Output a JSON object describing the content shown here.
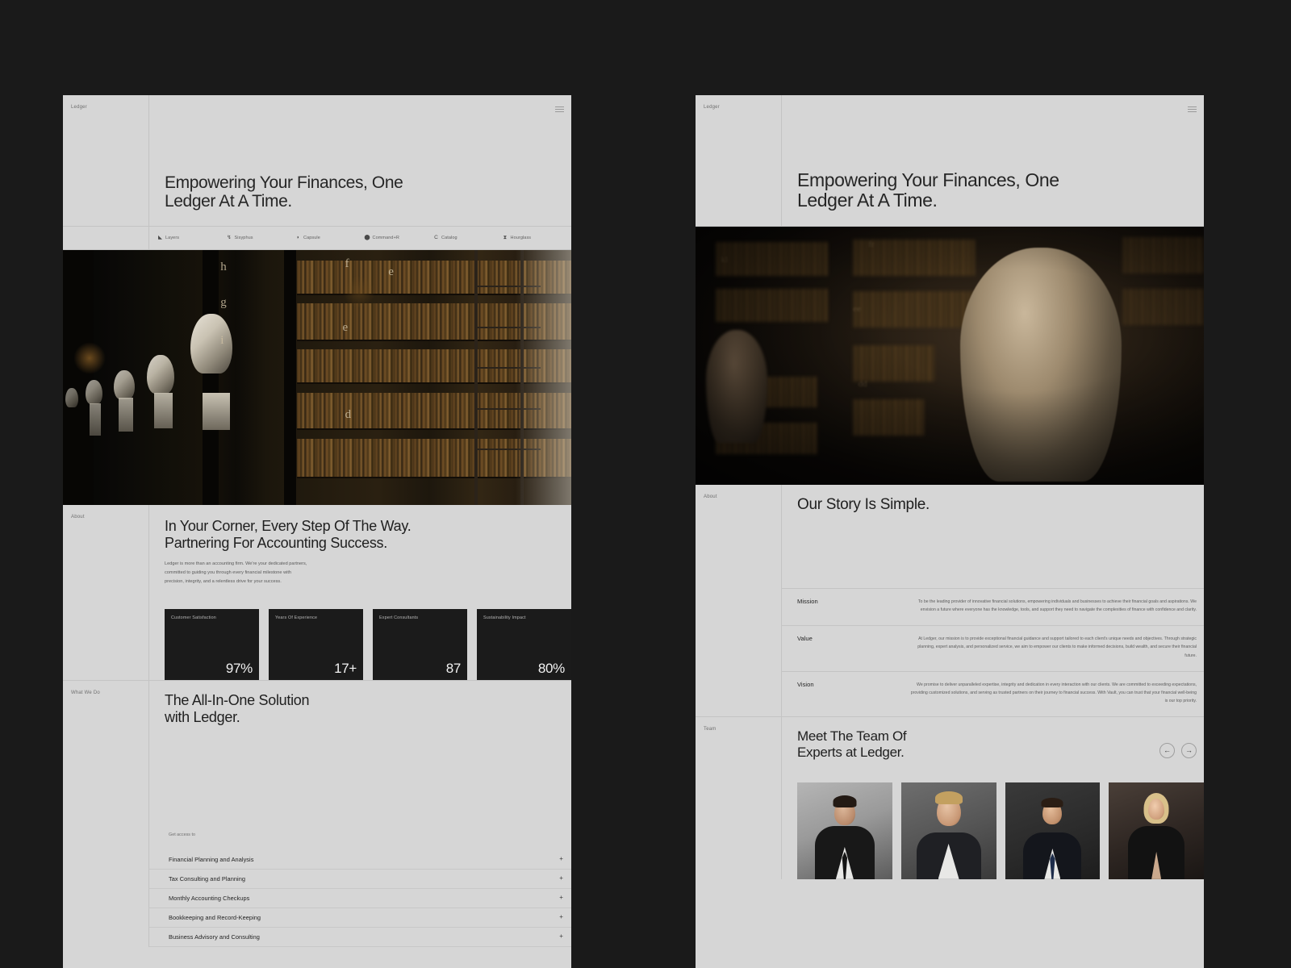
{
  "brand": "Ledger",
  "hero": {
    "title": "Empowering Your Finances, One\nLedger At A Time.",
    "menu_icon": "hamburger-icon"
  },
  "logos": [
    {
      "name": "Layers",
      "glyph": "◣"
    },
    {
      "name": "Sisyphus",
      "glyph": "↯"
    },
    {
      "name": "Capsule",
      "glyph": "◗"
    },
    {
      "name": "Command+R",
      "glyph": "⬤"
    },
    {
      "name": "Catalog",
      "glyph": "C"
    },
    {
      "name": "Hourglass",
      "glyph": "⧗"
    }
  ],
  "about": {
    "rail_label": "About",
    "heading": "In Your Corner, Every Step Of The Way.\nPartnering For Accounting Success.",
    "paragraph": "Ledger is more than an accounting firm. We're your dedicated partners, committed to guiding you through every financial milestone with precision, integrity, and a relentless drive for your success.",
    "stats": [
      {
        "label": "Customer Satisfaction",
        "value": "97%"
      },
      {
        "label": "Years Of Experience",
        "value": "17+"
      },
      {
        "label": "Expert Consultants",
        "value": "87"
      },
      {
        "label": "Sustainability Impact",
        "value": "80%"
      }
    ]
  },
  "what_we_do": {
    "rail_label": "What We Do",
    "heading": "The All-In-One Solution\nwith Ledger.",
    "get_access_label": "Get access to",
    "expand_icon": "+",
    "items": [
      "Financial Planning and Analysis",
      "Tax Consulting and Planning",
      "Monthly Accounting Checkups",
      "Bookkeeping and Record-Keeping",
      "Business Advisory and Consulting"
    ]
  },
  "story": {
    "rail_label": "About",
    "heading": "Our Story Is Simple.",
    "rows": [
      {
        "key": "Mission",
        "text": "To be the leading provider of innovative financial solutions, empowering individuals and businesses to achieve their financial goals and aspirations. We envision a future where everyone has the knowledge, tools, and support they need to navigate the complexities of finance with confidence and clarity."
      },
      {
        "key": "Value",
        "text": "At Ledger, our mission is to provide exceptional financial guidance and support tailored to each client's unique needs and objectives. Through strategic planning, expert analysis, and personalized service, we aim to empower our clients to make informed decisions, build wealth, and secure their financial future."
      },
      {
        "key": "Vision",
        "text": "We promise to deliver unparalleled expertise, integrity and dedication in every interaction with our clients. We are committed to exceeding expectations, providing customized solutions, and serving as trusted partners on their journey to financial success. With Vault, you can trust that your financial well-being is our top priority."
      }
    ]
  },
  "team": {
    "rail_label": "Team",
    "heading": "Meet The Team Of\nExperts at Ledger.",
    "prev_icon": "←",
    "next_icon": "→",
    "members": [
      {
        "portrait": "man-dark-hair-suit-phone"
      },
      {
        "portrait": "man-blonde-suit-white-shirt"
      },
      {
        "portrait": "man-smiling-suit-blue-tie"
      },
      {
        "portrait": "woman-blonde-black-blazer"
      }
    ]
  },
  "colors": {
    "page_background": "#1a1a1a",
    "panel_background": "#d6d6d6",
    "card_background": "#1b1b1b",
    "text_primary": "#1f1f1f",
    "text_muted": "#5d5d5d",
    "rule": "#c4c4c4"
  }
}
